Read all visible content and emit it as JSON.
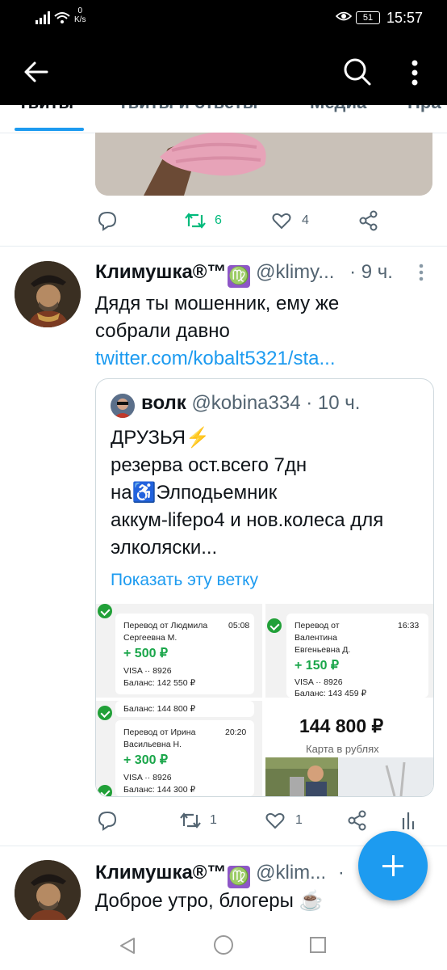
{
  "status": {
    "network_speed_value": "0",
    "network_speed_unit": "K/s",
    "battery": "51",
    "time": "15:57"
  },
  "tabs": [
    {
      "label": "Твиты"
    },
    {
      "label": "Твиты и ответы"
    },
    {
      "label": "Медиа"
    },
    {
      "label": "Нра"
    }
  ],
  "tweet1": {
    "retweets": "6",
    "likes": "4"
  },
  "tweet2": {
    "name": "Климушка®™",
    "zodiac": "♍",
    "handle": "@klimy...",
    "time": "· 9 ч.",
    "text_line1": "Дядя ты мошенник, ему же",
    "text_line2": "собрали давно",
    "link": "twitter.com/kobalt5321/sta...",
    "quote": {
      "name": "волк",
      "handle": "@kobina334",
      "time": "· 10 ч.",
      "lines": [
        "ДРУЗЬЯ⚡",
        "резерва ост.всего 7дн",
        "на♿Элподьемник",
        "аккум-lifepo4 и нов.колеса для",
        "элколяски..."
      ],
      "show_thread": "Показать эту ветку",
      "media": {
        "t1_name": "Перевод от Людмила",
        "t1_name2": "Сергеевна М.",
        "t1_time": "05:08",
        "t1_amount": "+ 500 ₽",
        "t1_card": "VISA ·· 8926",
        "t1_balance": "Баланс: 142 550 ₽",
        "t2_name": "Перевод от",
        "t2_name2": "Валентина",
        "t2_name3": "Евгеньевна Д.",
        "t2_time": "16:33",
        "t2_amount": "+ 150 ₽",
        "t2_card": "VISA ·· 8926",
        "t2_balance": "Баланс: 143 459 ₽",
        "t3_top": "Баланс: 144 800 ₽",
        "t3_name": "Перевод от Ирина",
        "t3_name2": "Васильевна Н.",
        "t3_time": "20:20",
        "t3_amount": "+ 300 ₽",
        "t3_card": "VISA ·· 8926",
        "t3_balance": "Баланс: 144 300 ₽",
        "t4_big": "144 800 ₽",
        "t4_sub": "Карта в рублях"
      }
    },
    "retweets": "1",
    "likes": "1"
  },
  "tweet3": {
    "name": "Климушка®™",
    "zodiac": "♍",
    "handle": "@klim...",
    "time": "·",
    "text": "Доброе утро, блогеры ☕"
  },
  "colors": {
    "accent": "#1d9bf0",
    "retweet_active": "#00ba7c",
    "header": "#000000"
  }
}
